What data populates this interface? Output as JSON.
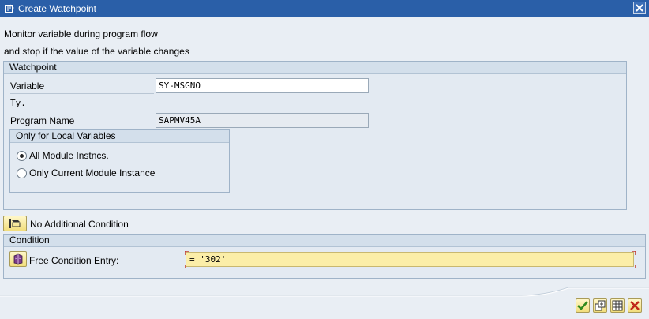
{
  "window": {
    "title": "Create Watchpoint"
  },
  "description": {
    "line1": "Monitor variable during program flow",
    "line2": "and stop if the value of the variable changes"
  },
  "watchpoint_group": {
    "title": "Watchpoint",
    "variable_label": "Variable",
    "variable_value": "SY-MSGNO",
    "type_label": "Ty.",
    "program_label": "Program Name",
    "program_value": "SAPMV45A"
  },
  "local_group": {
    "title": "Only for Local Variables",
    "options": [
      {
        "label": "All Module Instncs.",
        "selected": true
      },
      {
        "label": "Only Current Module Instance",
        "selected": false
      }
    ]
  },
  "additional_condition": {
    "label": "No Additional Condition"
  },
  "condition_group": {
    "title": "Condition",
    "free_label": "Free Condition Entry:",
    "free_value": "= '302'"
  },
  "colors": {
    "titlebar": "#2a5fa8",
    "condition_field": "#fbeea8",
    "button_yellow": "#f2de7c"
  },
  "footer_buttons": [
    {
      "icon": "check-icon"
    },
    {
      "icon": "new-icon"
    },
    {
      "icon": "grid-icon"
    },
    {
      "icon": "cancel-icon"
    }
  ]
}
